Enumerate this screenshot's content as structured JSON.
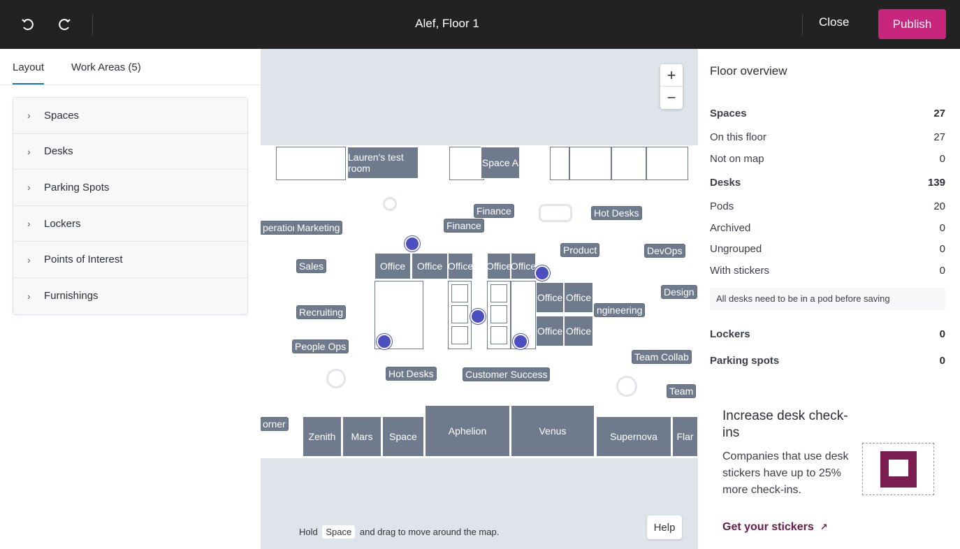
{
  "topbar": {
    "title": "Alef, Floor 1",
    "close_label": "Close",
    "publish_label": "Publish",
    "icons": [
      "undo-icon",
      "redo-icon"
    ],
    "publish_color": "#c8257c"
  },
  "left_panel": {
    "tabs": [
      {
        "label": "Layout",
        "active": true
      },
      {
        "label": "Work Areas (5)",
        "active": false
      }
    ],
    "accordion": [
      "Spaces",
      "Desks",
      "Parking Spots",
      "Lockers",
      "Points of Interest",
      "Furnishings"
    ]
  },
  "map": {
    "rooms": [
      "Lauren's test room",
      "Space A",
      "Zenith",
      "Mars",
      "Space",
      "Aphelion",
      "Venus",
      "Supernova",
      "Flar",
      "Office",
      "Office",
      "Office",
      "Office",
      "Office",
      "Office",
      "Office",
      "Office",
      "Office"
    ],
    "labels": [
      "Finance",
      "Finance",
      "Hot Desks",
      "perations",
      "Marketing",
      "Product",
      "DevOps",
      "Sales",
      "Design",
      "Recruiting",
      "ngineering",
      "People Ops",
      "Team Collab",
      "Hot Desks",
      "Customer Success",
      "Team",
      "orner"
    ],
    "zoom_in": "+",
    "zoom_out": "−",
    "hint_before": "Hold",
    "hint_key": "Space",
    "hint_after": "and drag to move around the map.",
    "help_label": "Help"
  },
  "right_panel": {
    "title": "Floor overview",
    "stats": [
      {
        "label": "Spaces",
        "value": "27",
        "bold": true
      },
      {
        "label": "On this floor",
        "value": "27"
      },
      {
        "label": "Not on map",
        "value": "0"
      },
      {
        "label": "Desks",
        "value": "139",
        "bold": true
      },
      {
        "label": "Pods",
        "value": "20"
      },
      {
        "label": "Archived",
        "value": "0"
      },
      {
        "label": "Ungrouped",
        "value": "0"
      },
      {
        "label": "With stickers",
        "value": "0"
      }
    ],
    "notice": "All desks need to be in a pod before saving",
    "lockers": {
      "label": "Lockers",
      "value": "0"
    },
    "parking": {
      "label": "Parking spots",
      "value": "0"
    },
    "promo": {
      "title": "Increase desk check-ins",
      "body": "Companies that use desk stickers have up to 25% more check-ins.",
      "link": "Get your stickers",
      "link_color": "#6b1b45"
    }
  }
}
